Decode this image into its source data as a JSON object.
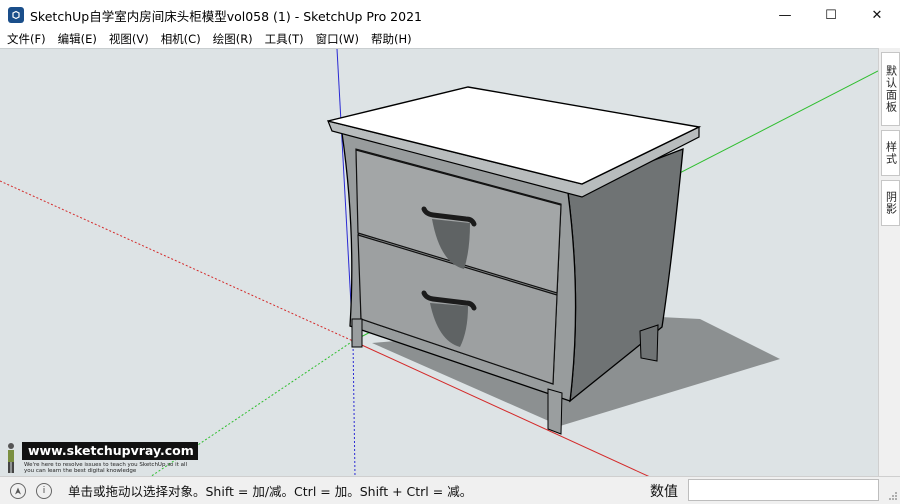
{
  "window": {
    "title": "SketchUp自学室内房间床头柜模型vol058 (1) - SketchUp Pro 2021",
    "minimize": "—",
    "maximize": "☐",
    "close": "✕"
  },
  "menu": [
    "文件(F)",
    "编辑(E)",
    "视图(V)",
    "相机(C)",
    "绘图(R)",
    "工具(T)",
    "窗口(W)",
    "帮助(H)"
  ],
  "side_tabs": [
    "默认面板",
    "样式",
    "阴影"
  ],
  "watermark": {
    "url": "www.sketchupvray.com",
    "tagline": "We're here to resolve issues to teach you SketchUp so it all you can learn the best digital knowledge"
  },
  "status": {
    "hint": "单击或拖动以选择对象。Shift = 加/减。Ctrl = 加。Shift + Ctrl = 减。",
    "measurements_label": "数值",
    "measurements_value": ""
  },
  "colors": {
    "viewport_bg": "#dde3e5",
    "axis_red": "#d42a2a",
    "axis_green": "#2fbe2f",
    "axis_blue": "#2a2ad4",
    "app_icon": "#1a4e8a"
  }
}
